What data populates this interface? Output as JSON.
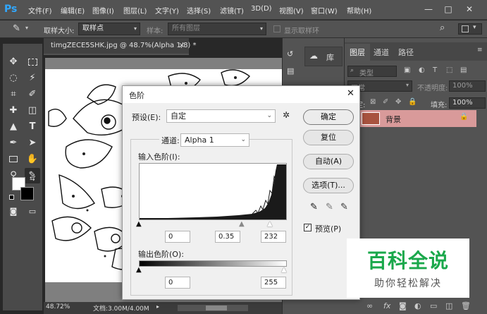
{
  "app": {
    "logo": "Ps",
    "menu": [
      "文件(F)",
      "编辑(E)",
      "图像(I)",
      "图层(L)",
      "文字(Y)",
      "选择(S)",
      "滤镜(T)",
      "3D(D)",
      "视图(V)",
      "窗口(W)",
      "帮助(H)"
    ],
    "window_buttons": [
      "—",
      "□",
      "✕"
    ]
  },
  "options": {
    "sample_size_label": "取样大小:",
    "sample_size_value": "取样点",
    "sample_label": "样本:",
    "sample_value": "所有图层",
    "show_ring_label": "显示取样环"
  },
  "document": {
    "tab_title": "timgZECE5SHK.jpg @ 48.7%(Alpha 1/8) *",
    "close": "×",
    "zoom": "48.72%",
    "doc_info": "文档:3.00M/4.00M"
  },
  "mid_panel": {
    "library_label": "库"
  },
  "layers_panel": {
    "tabs": [
      "图层",
      "通道",
      "路径"
    ],
    "filter_kind": "类型",
    "blend_mode": "正常",
    "opacity_label": "不透明度:",
    "opacity_value": "100%",
    "lock_label": "锁定:",
    "fill_label": "填充:",
    "fill_value": "100%",
    "layer_name": "背景"
  },
  "levels_dialog": {
    "title": "色阶",
    "preset_label": "预设(E):",
    "preset_value": "自定",
    "channel_label": "通道:",
    "channel_value": "Alpha 1",
    "input_levels_label": "输入色阶(I):",
    "input_black": "0",
    "input_gamma": "0.35",
    "input_white": "232",
    "output_levels_label": "输出色阶(O):",
    "output_black": "0",
    "output_white": "255",
    "buttons": {
      "ok": "确定",
      "reset": "复位",
      "auto": "自动(A)",
      "options": "选项(T)..."
    },
    "preview_label": "预览(P)",
    "preview_checked": true
  },
  "watermark": {
    "main": "百科全说",
    "sub": "助你轻松解决"
  },
  "colors": {
    "ui_panel": "#535353",
    "workspace": "#282828",
    "layer_highlight": "#d99a9a",
    "watermark_green": "#1aa84b"
  }
}
